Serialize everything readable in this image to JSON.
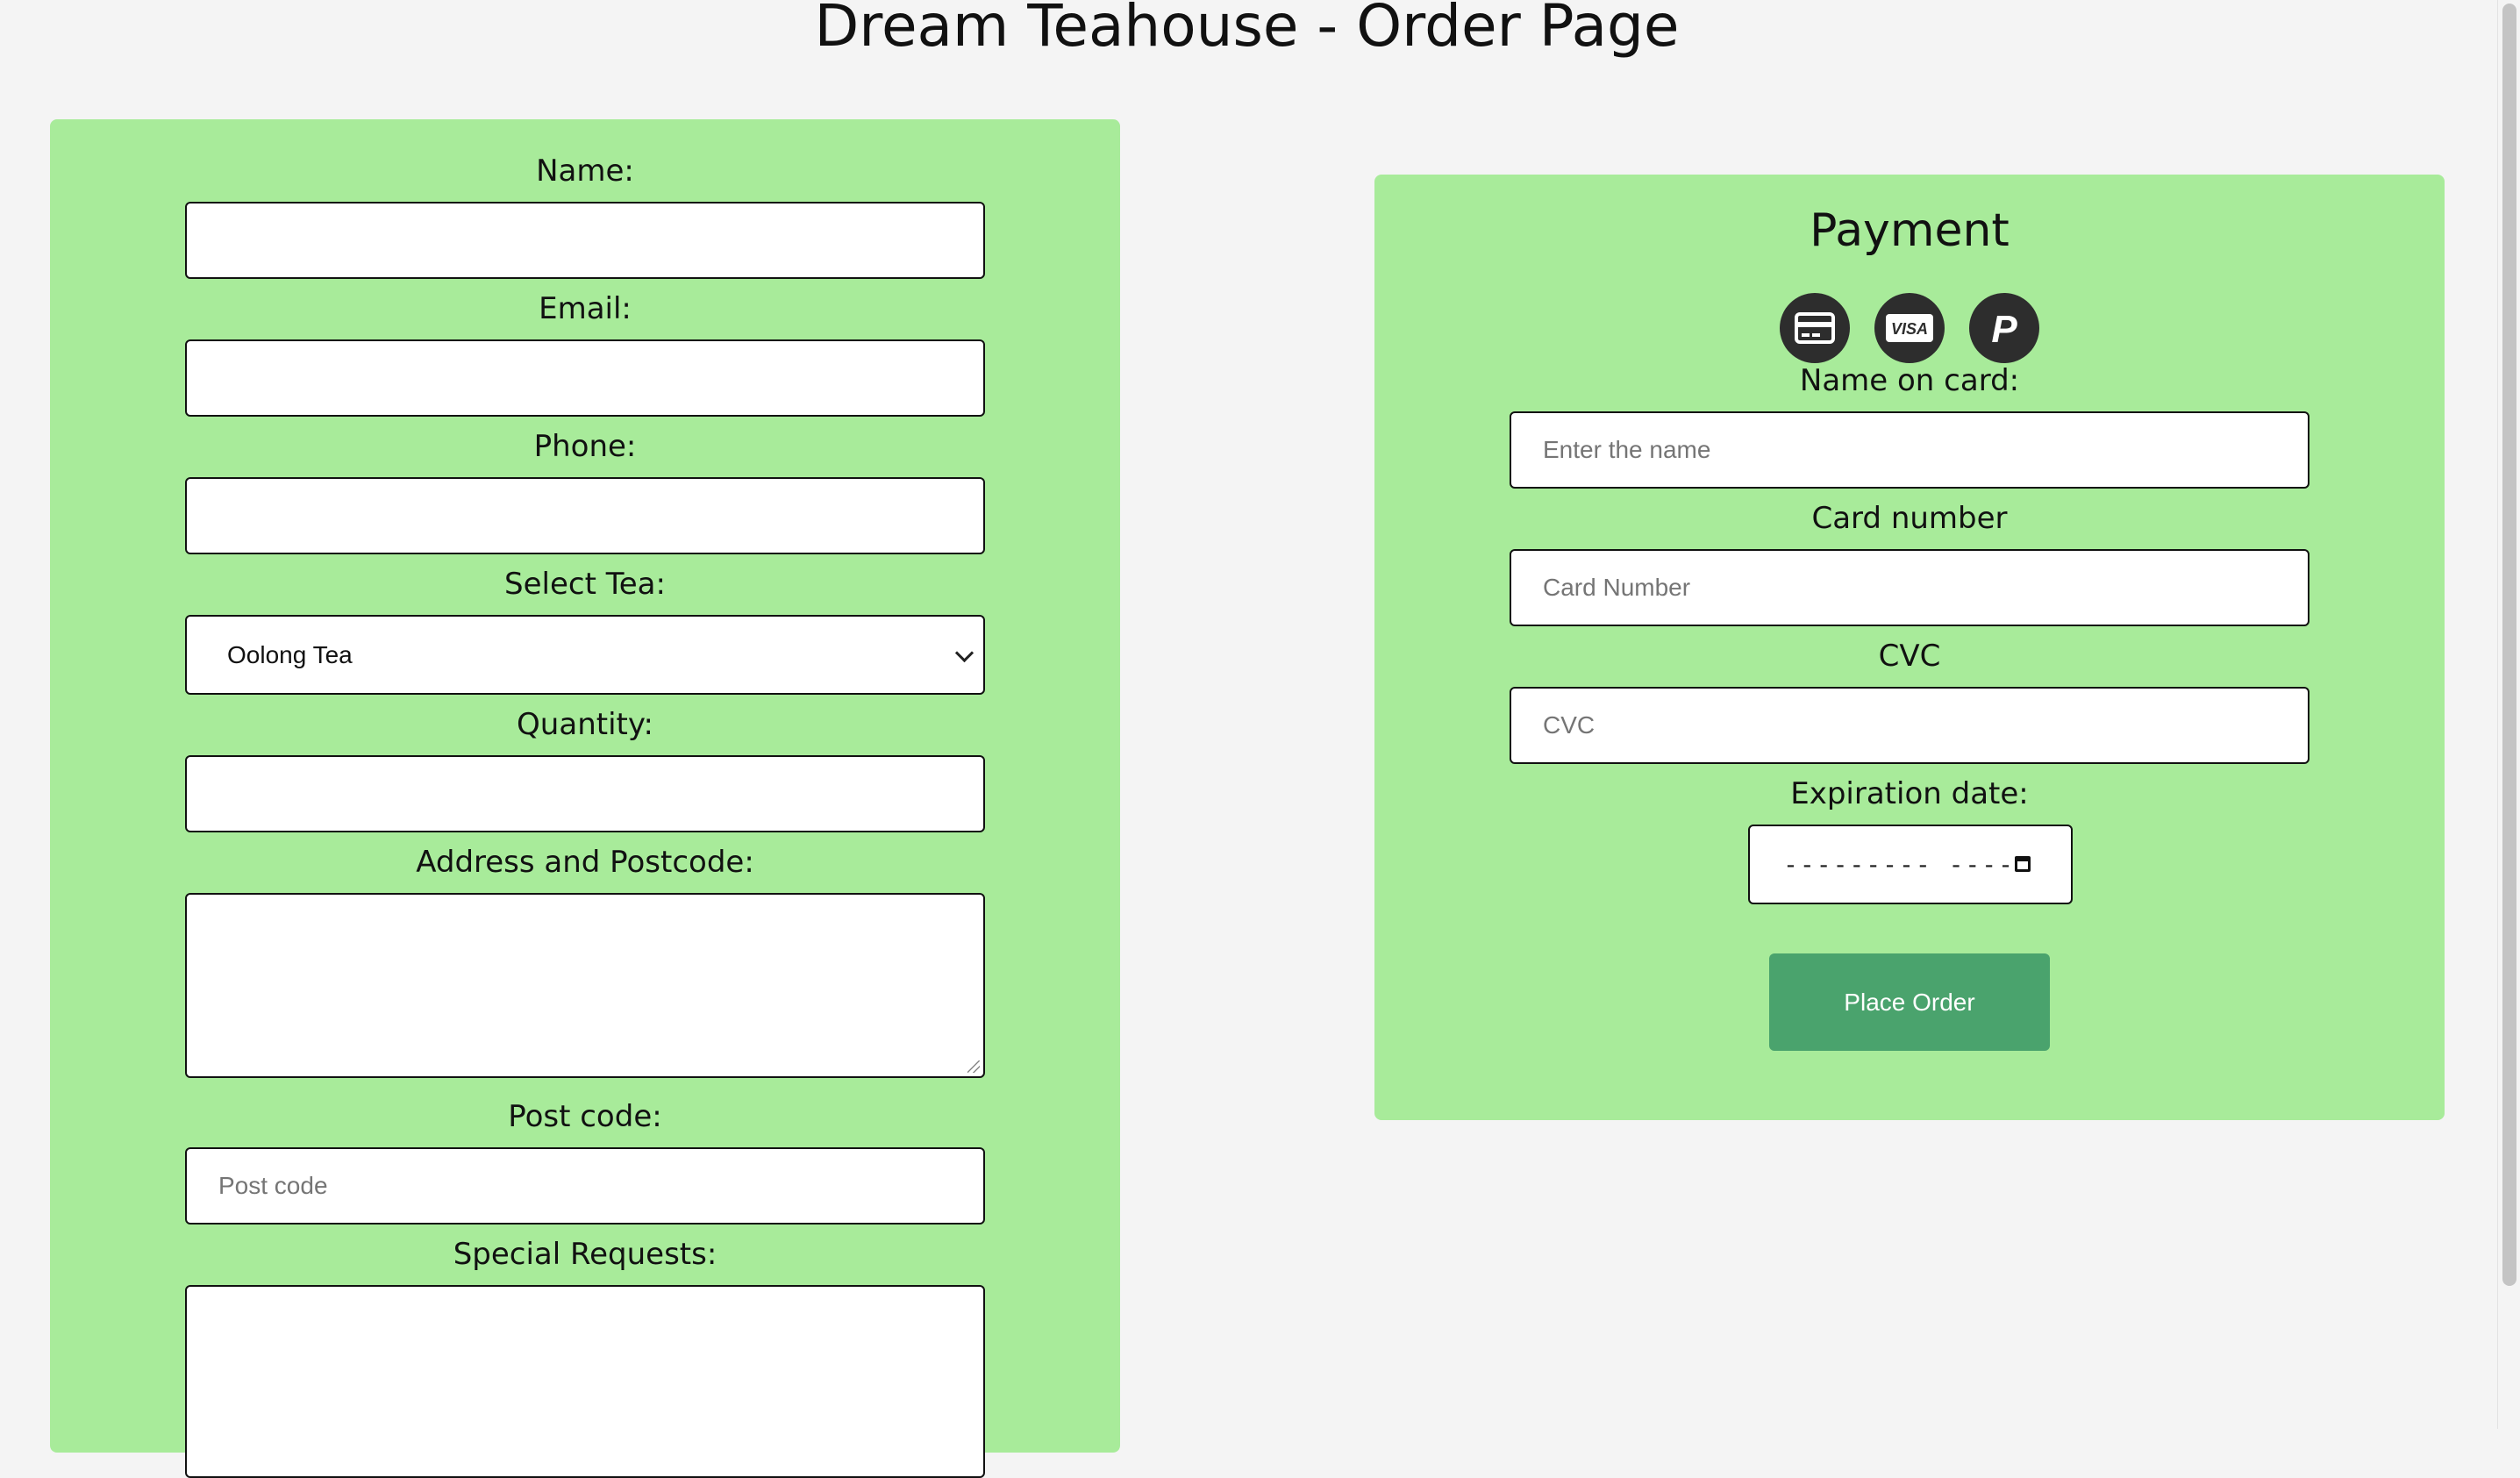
{
  "page": {
    "title": "Dream Teahouse - Order Page"
  },
  "order_form": {
    "name": {
      "label": "Name:",
      "value": ""
    },
    "email": {
      "label": "Email:",
      "value": ""
    },
    "phone": {
      "label": "Phone:",
      "value": ""
    },
    "tea": {
      "label": "Select Tea:",
      "selected": "Oolong Tea"
    },
    "quantity": {
      "label": "Quantity:",
      "value": ""
    },
    "address": {
      "label": "Address and Postcode:",
      "value": ""
    },
    "postcode": {
      "label": "Post code:",
      "placeholder": "Post code",
      "value": ""
    },
    "special_requests": {
      "label": "Special Requests:",
      "value": ""
    }
  },
  "payment": {
    "title": "Payment",
    "methods": [
      {
        "icon": "credit-card-icon"
      },
      {
        "icon": "visa-icon",
        "text": "VISA"
      },
      {
        "icon": "paypal-icon",
        "text": "P"
      }
    ],
    "name_on_card": {
      "label": "Name on card:",
      "placeholder": "Enter the name"
    },
    "card_number": {
      "label": "Card number",
      "placeholder": "Card Number"
    },
    "cvc": {
      "label": "CVC",
      "placeholder": "CVC"
    },
    "expiration": {
      "label": "Expiration date:",
      "display": "--------- ----"
    },
    "submit_label": "Place Order"
  },
  "colors": {
    "page_bg": "#f4f4f4",
    "panel_bg": "#a8eb9a",
    "button_bg": "#4aa36d",
    "icon_bg": "#2d2d2d"
  }
}
